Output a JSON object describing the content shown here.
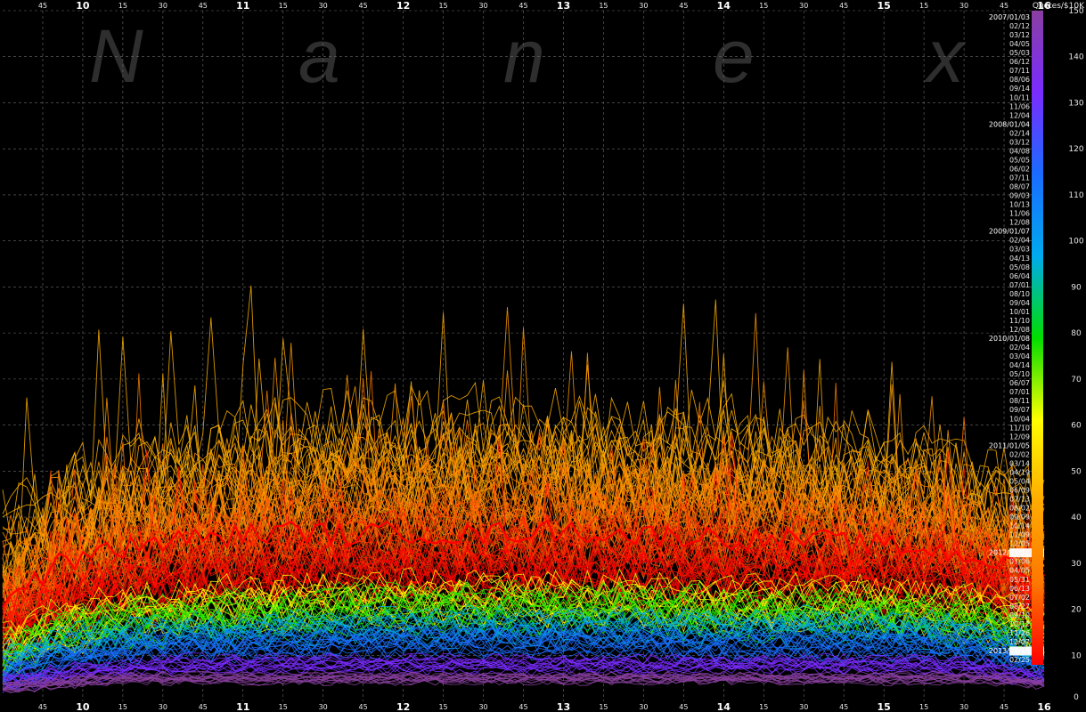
{
  "watermark": [
    "N",
    "a",
    "n",
    "e",
    "x"
  ],
  "chart_data": {
    "type": "line",
    "title": "",
    "xlabel": "",
    "ylabel": "",
    "units_label": "Quotes/$10K",
    "x_major_ticks": [
      "10",
      "11",
      "12",
      "13",
      "14",
      "15",
      "16"
    ],
    "x_minor_ticks": [
      "15",
      "30",
      "45"
    ],
    "x_range": [
      "09:30",
      "16:00"
    ],
    "ylim": [
      0,
      150
    ],
    "yticks": [
      0,
      10,
      20,
      30,
      40,
      50,
      60,
      70,
      80,
      90,
      100,
      110,
      120,
      130,
      140,
      150
    ],
    "grid": true,
    "colorbar": {
      "range": [
        0,
        150
      ],
      "stops": [
        "#ff0000",
        "#ff7700",
        "#ffaa00",
        "#ffff00",
        "#00dd00",
        "#00aaee",
        "#1a6cff",
        "#7a2cff",
        "#8a3fa0"
      ]
    },
    "date_labels": [
      "2007/01/03",
      "02/12",
      "03/12",
      "04/05",
      "05/03",
      "06/12",
      "07/11",
      "08/06",
      "09/14",
      "10/11",
      "11/06",
      "12/04",
      "2008/01/04",
      "02/14",
      "03/12",
      "04/08",
      "05/05",
      "06/02",
      "07/11",
      "08/07",
      "09/03",
      "10/13",
      "11/06",
      "12/08",
      "2009/01/07",
      "02/04",
      "03/03",
      "04/13",
      "05/08",
      "06/04",
      "07/01",
      "08/10",
      "09/04",
      "10/01",
      "11/10",
      "12/08",
      "2010/01/08",
      "02/04",
      "03/04",
      "04/14",
      "05/10",
      "06/07",
      "07/01",
      "08/11",
      "09/07",
      "10/04",
      "11/10",
      "12/09",
      "2011/01/05",
      "02/02",
      "03/14",
      "04/19",
      "05/04",
      "06/09",
      "07/13",
      "08/02",
      "09/09",
      "10/14",
      "11/09",
      "12/05",
      "2012/01/11",
      "03/06",
      "04/05",
      "05/31",
      "06/13",
      "07/02",
      "08/27",
      "09/10",
      "10/12",
      "11/26",
      "12/07",
      "2013/01/15",
      "02/25"
    ],
    "highlighted_dates": [
      "2012/01/11",
      "2013/01/15"
    ],
    "series": [
      {
        "period": "2007",
        "color": "#ffb000",
        "level": [
          30,
          40,
          45,
          48,
          50,
          51,
          52,
          52,
          52,
          52,
          52,
          52,
          51,
          50,
          49,
          48,
          46,
          42,
          34
        ]
      },
      {
        "period": "2008",
        "color": "#ff9900",
        "level": [
          25,
          34,
          40,
          42,
          44,
          45,
          46,
          46,
          46,
          46,
          46,
          46,
          45,
          45,
          44,
          43,
          41,
          38,
          30
        ]
      },
      {
        "period": "2009",
        "color": "#ff7a00",
        "level": [
          22,
          30,
          35,
          38,
          39,
          40,
          41,
          41,
          41,
          41,
          41,
          41,
          40,
          40,
          39,
          38,
          37,
          34,
          27
        ]
      },
      {
        "period": "2010",
        "color": "#ff5500",
        "level": [
          20,
          27,
          31,
          33,
          34,
          35,
          36,
          36,
          36,
          36,
          36,
          36,
          35,
          35,
          35,
          34,
          33,
          30,
          24
        ]
      },
      {
        "period": "2011",
        "color": "#ff1a00",
        "level": [
          18,
          24,
          28,
          30,
          31,
          31,
          32,
          32,
          32,
          32,
          32,
          32,
          32,
          31,
          31,
          31,
          30,
          28,
          22
        ]
      },
      {
        "period": "2012a",
        "color": "#ff0000",
        "level": [
          15,
          20,
          24,
          25,
          26,
          27,
          27,
          27,
          27,
          27,
          27,
          27,
          27,
          27,
          27,
          26,
          26,
          24,
          19
        ]
      },
      {
        "period": "2012b",
        "color": "#ffff00",
        "level": [
          11,
          16,
          19,
          20,
          21,
          21,
          22,
          22,
          22,
          22,
          22,
          22,
          21,
          21,
          21,
          21,
          20,
          19,
          15
        ]
      },
      {
        "period": "2012c",
        "color": "#22ee00",
        "level": [
          10,
          15,
          17,
          18,
          19,
          19,
          20,
          20,
          20,
          20,
          20,
          20,
          19,
          19,
          19,
          19,
          18,
          17,
          13
        ]
      },
      {
        "period": "2012d",
        "color": "#00aaee",
        "level": [
          8,
          12,
          14,
          15,
          15,
          16,
          16,
          16,
          16,
          16,
          16,
          16,
          16,
          16,
          16,
          16,
          15,
          14,
          10
        ]
      },
      {
        "period": "2013a",
        "color": "#1a6cff",
        "level": [
          6,
          9,
          11,
          12,
          12,
          12,
          13,
          13,
          13,
          13,
          13,
          13,
          12,
          12,
          12,
          12,
          12,
          11,
          8
        ]
      },
      {
        "period": "2013b",
        "color": "#7a2cff",
        "level": [
          4,
          6,
          7,
          8,
          8,
          8,
          8,
          8,
          8,
          8,
          8,
          8,
          8,
          8,
          8,
          8,
          8,
          7,
          5
        ]
      },
      {
        "period": "2013c",
        "color": "#8a3fa0",
        "level": [
          3,
          4,
          5,
          5,
          5,
          5,
          5,
          5,
          5,
          5,
          5,
          5,
          5,
          5,
          5,
          5,
          5,
          5,
          4
        ]
      }
    ],
    "median_line": {
      "color": "#ff0000",
      "level": [
        22,
        30,
        33,
        35,
        36,
        37,
        36,
        37,
        36,
        37,
        37,
        36,
        36,
        35,
        35,
        34,
        33,
        31,
        26
      ]
    }
  }
}
